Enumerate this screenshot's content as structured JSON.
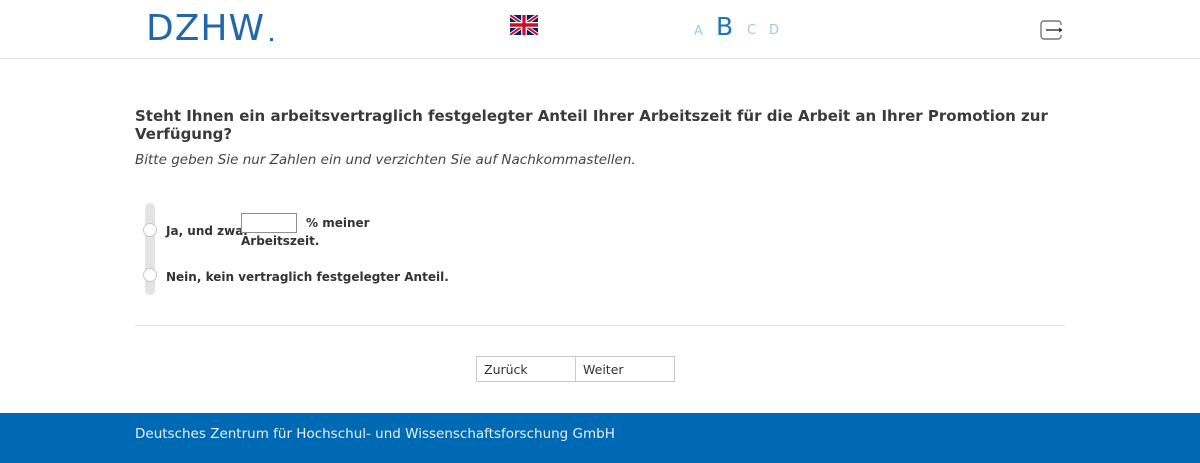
{
  "header": {
    "logo_text": "DZHW",
    "language_flag": "uk-flag-icon",
    "steps": [
      "A",
      "B",
      "C",
      "D"
    ],
    "active_step": "B",
    "logout_icon": "logout-icon"
  },
  "question": {
    "title": "Steht Ihnen ein arbeitsvertraglich festgelegter Anteil Ihrer Arbeitszeit für die Arbeit an Ihrer Promotion zur Verfügung?",
    "instruction": "Bitte geben Sie nur Zahlen ein und verzichten Sie auf Nachkommastellen."
  },
  "options": [
    {
      "label_before": "Ja, und zwar",
      "input_value": "",
      "label_after_1": "% meiner",
      "label_after_2": "Arbeitszeit."
    },
    {
      "label": "Nein, kein vertraglich festgelegter Anteil."
    }
  ],
  "buttons": {
    "back": "Zurück",
    "next": "Weiter"
  },
  "footer": {
    "text": "Deutsches Zentrum für Hochschul- und Wissenschaftsforschung GmbH"
  },
  "colors": {
    "brand_blue": "#2467a8",
    "footer_blue": "#0069b4",
    "step_active": "#1b75bc",
    "step_inactive": "#9ccbea"
  }
}
